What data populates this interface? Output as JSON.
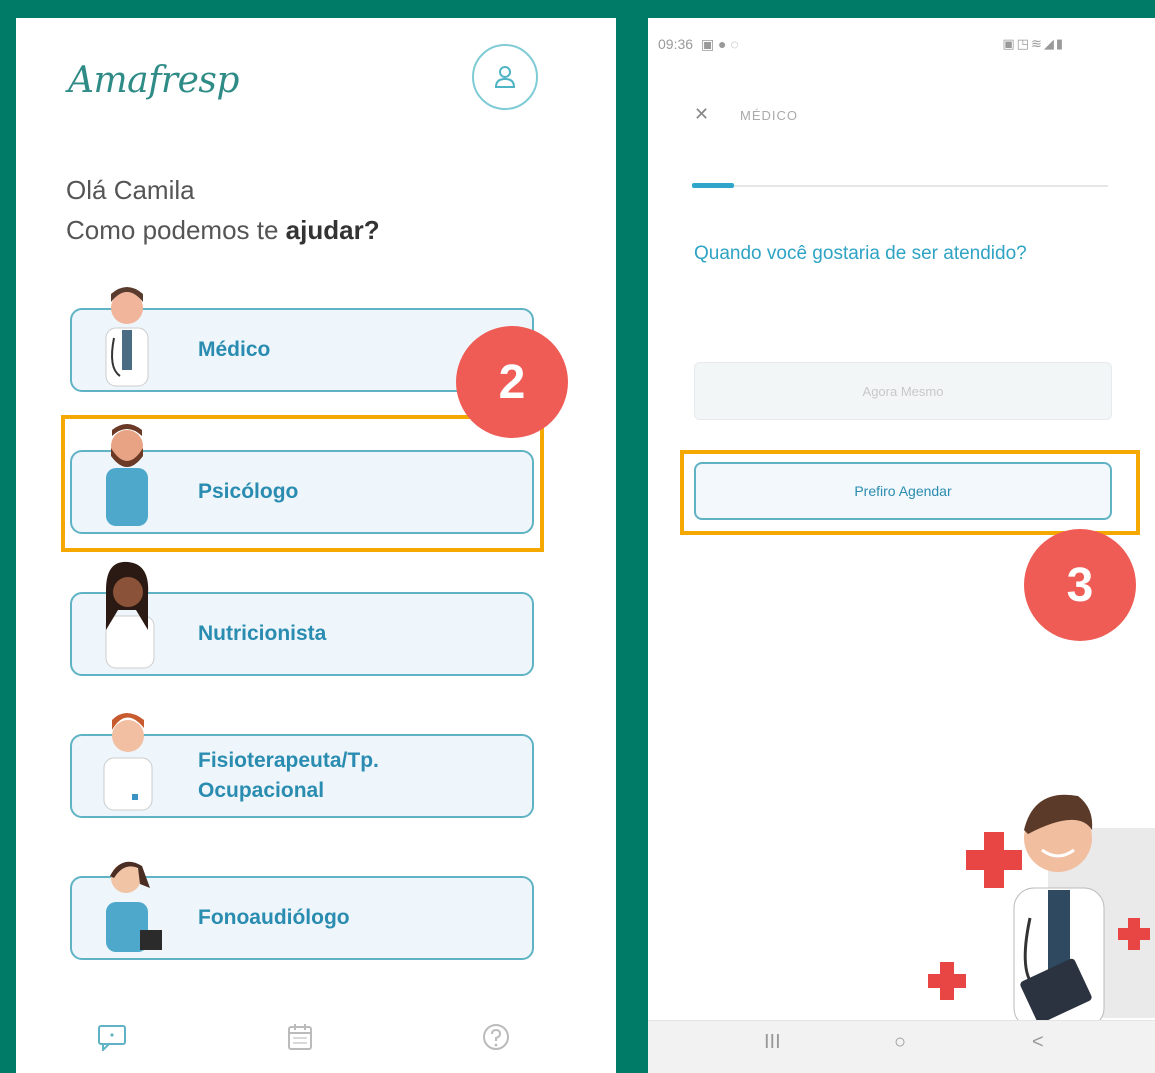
{
  "left": {
    "logo": "Amafresp",
    "greeting_prefix": "Olá ",
    "user_name": "Camila",
    "help_prefix": "Como podemos te ",
    "help_bold": "ajudar?",
    "services": [
      {
        "label": "Médico"
      },
      {
        "label": "Psicólogo"
      },
      {
        "label": "Nutricionista"
      },
      {
        "label": "Fisioterapeuta/Tp. Ocupacional"
      },
      {
        "label": "Fonoaudiólogo"
      }
    ],
    "nav": [
      {
        "icon": "chat-icon"
      },
      {
        "icon": "calendar-icon"
      },
      {
        "icon": "help-icon"
      }
    ]
  },
  "right": {
    "status_time": "09:36",
    "title": "MÉDICO",
    "question": "Quando você gostaria de ser atendido?",
    "btn_now": "Agora Mesmo",
    "btn_schedule": "Prefiro Agendar",
    "sys_nav": {
      "recent": "III",
      "home": "○",
      "back": "<"
    }
  },
  "annotations": {
    "step2": "2",
    "step3": "3",
    "highlight_color": "#F5A800",
    "badge_color": "#EF5B55"
  }
}
